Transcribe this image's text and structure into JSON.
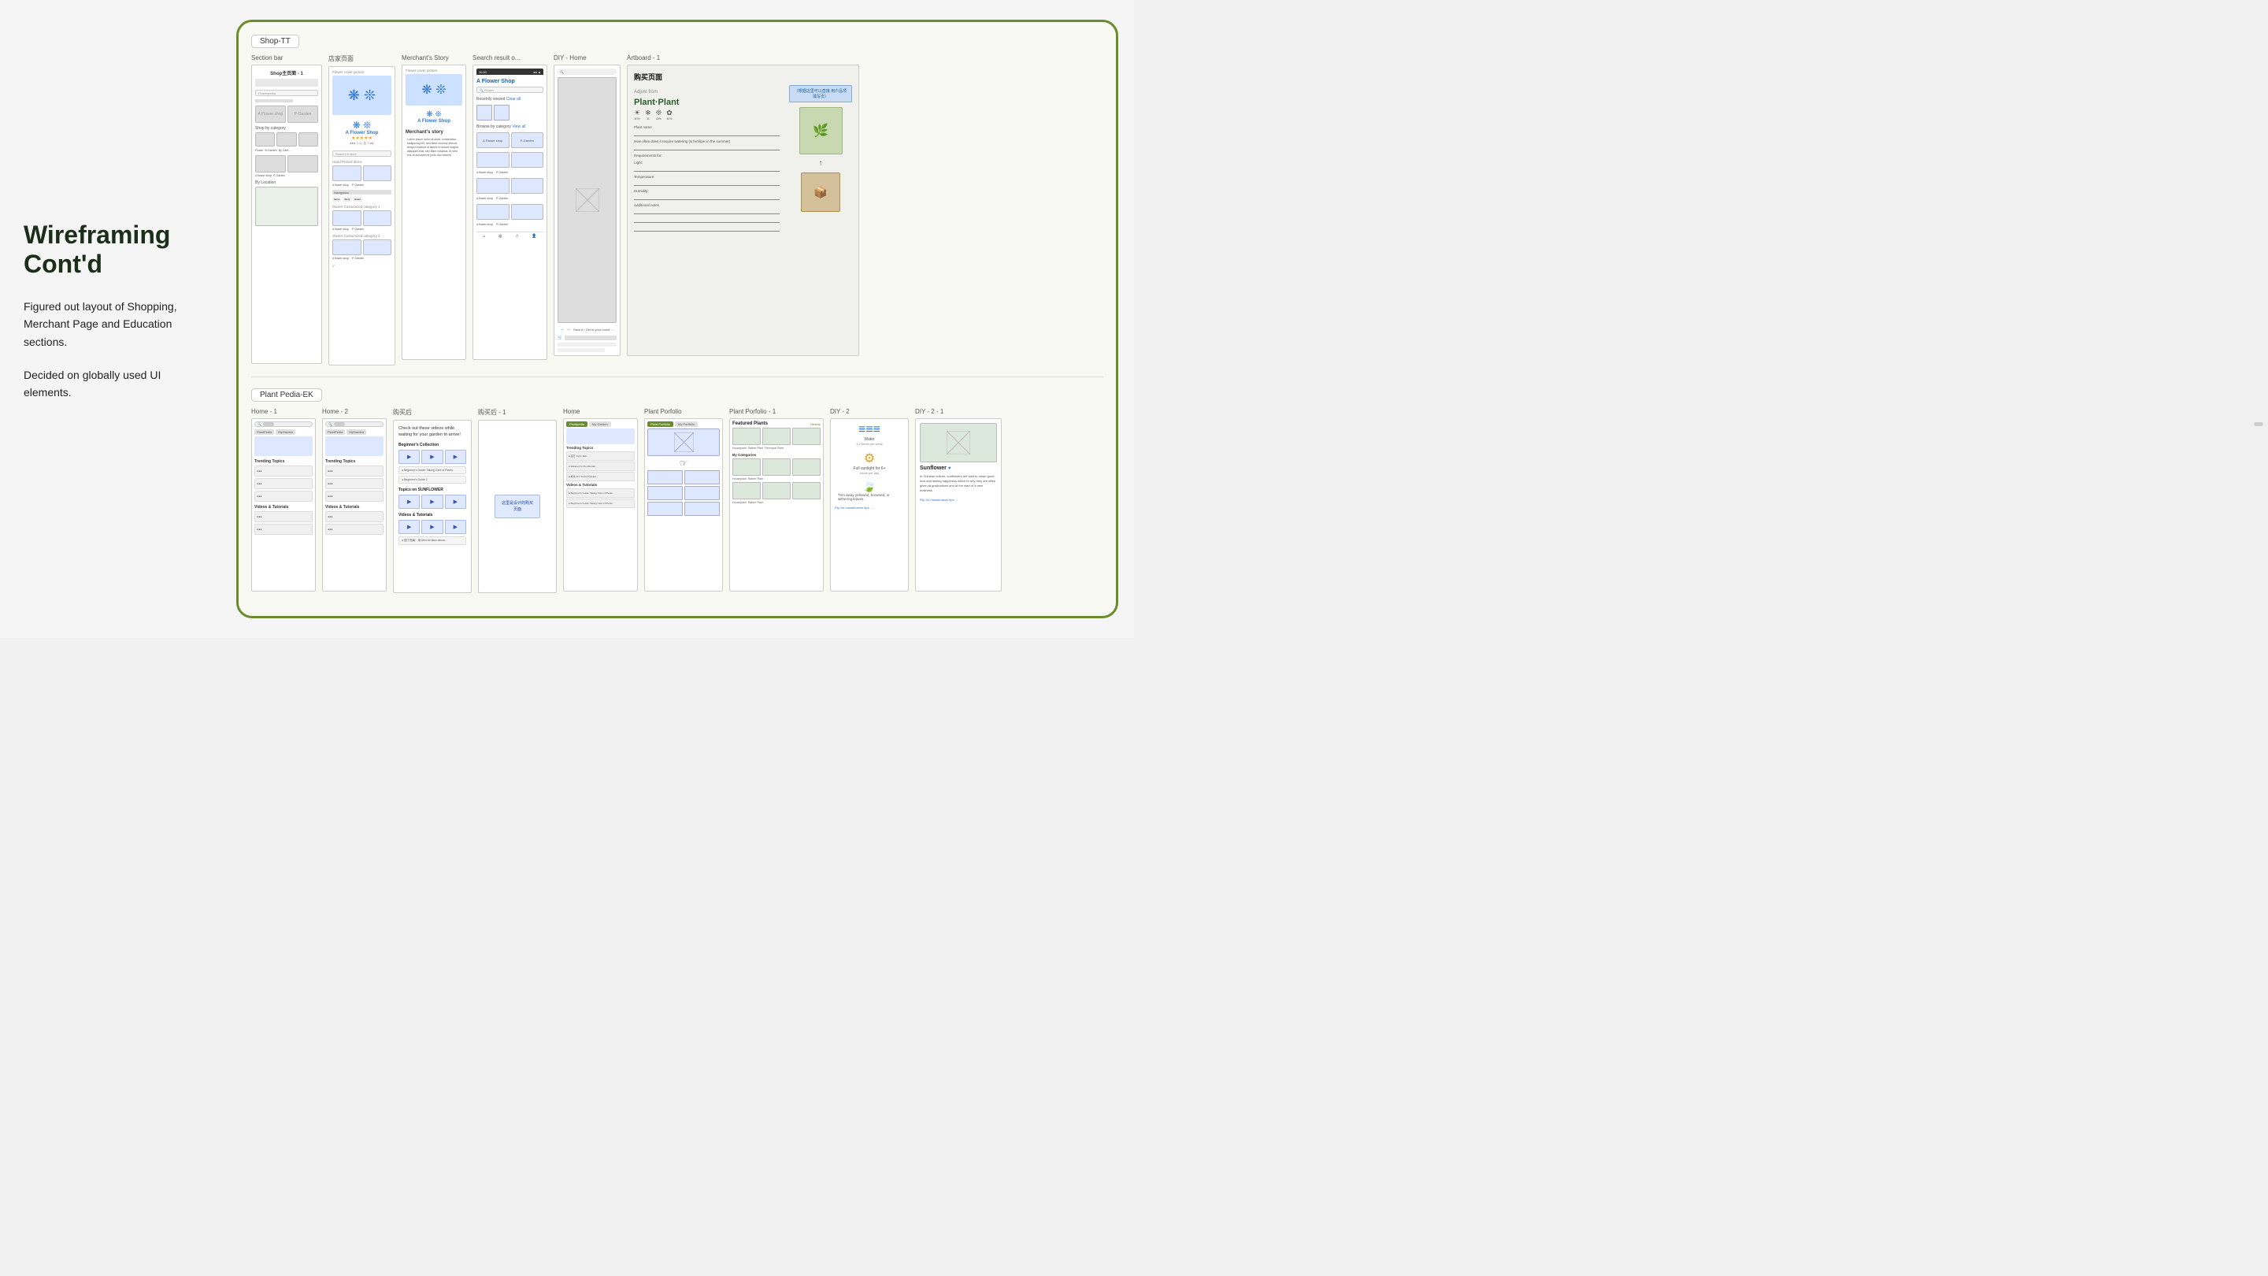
{
  "page": {
    "background": "#f5f5f5",
    "title": "Wireframing Cont'd"
  },
  "left_panel": {
    "heading_line1": "Wireframing",
    "heading_line2": "Cont'd",
    "paragraph1": "Figured out layout of Shopping, Merchant Page and Education sections.",
    "paragraph2": "Decided on globally used UI elements."
  },
  "top_section": {
    "section_label": "Shop-TT",
    "frames": [
      {
        "label": "Section bar",
        "type": "section_bar"
      },
      {
        "label": "店家页面",
        "type": "merchant_page"
      },
      {
        "label": "Merchant's Story",
        "type": "merchants_story"
      },
      {
        "label": "Search result o...",
        "type": "search_result"
      },
      {
        "label": "DIY - Home",
        "type": "diy_home"
      },
      {
        "label": "Artboard - 1",
        "type": "artboard_1"
      }
    ]
  },
  "bottom_section": {
    "section_label": "Plant Pedia-EK",
    "frames": [
      {
        "label": "Home - 1",
        "type": "home_1"
      },
      {
        "label": "Home - 2",
        "type": "home_2"
      },
      {
        "label": "购买后",
        "type": "purchase_after"
      },
      {
        "label": "购买后 - 1",
        "type": "purchase_after_1"
      },
      {
        "label": "Home",
        "type": "pp_home"
      },
      {
        "label": "Plant Porfolio",
        "type": "plant_portfolio"
      },
      {
        "label": "Plant Porfolio - 1",
        "type": "plant_portfolio_1"
      },
      {
        "label": "DIY - 2",
        "type": "diy_2"
      },
      {
        "label": "DIY - 2 - 1",
        "type": "diy_2_1"
      }
    ]
  },
  "featured_plants": {
    "title": "Featured Plants"
  },
  "artboard1": {
    "title": "购买页面",
    "chinese_label": "（根据这里可以直接 用户品项填写页）",
    "plant_name": "Plant Plant",
    "plant_name_cn": "Plant Plant",
    "form_labels": [
      "Plant name",
      "How often does it require watering (& fertilizer in the summer)",
      "Requirements for:",
      "Light:",
      "Temperature:",
      "Humidity:",
      "Additional notes:"
    ],
    "icons": [
      "☀",
      "❄",
      "✿",
      "❋"
    ]
  }
}
